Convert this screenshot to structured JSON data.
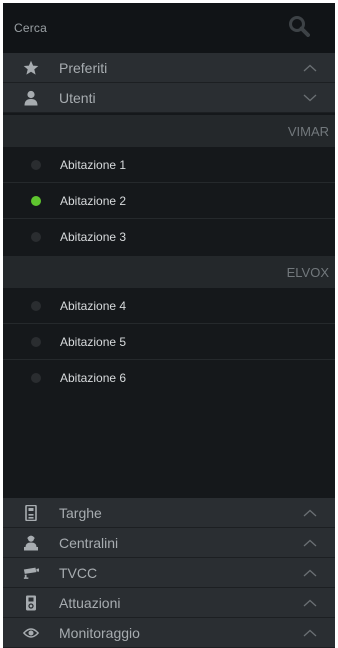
{
  "search": {
    "placeholder": "Cerca",
    "icon": "search-icon"
  },
  "sections_top": [
    {
      "label": "Preferiti",
      "icon": "star-icon",
      "expanded": false
    },
    {
      "label": "Utenti",
      "icon": "user-icon",
      "expanded": true
    }
  ],
  "groups": [
    {
      "name": "VIMAR",
      "users": [
        {
          "label": "Abitazione 1",
          "online": false
        },
        {
          "label": "Abitazione 2",
          "online": true
        },
        {
          "label": "Abitazione 3",
          "online": false
        }
      ]
    },
    {
      "name": "ELVOX",
      "users": [
        {
          "label": "Abitazione 4",
          "online": false
        },
        {
          "label": "Abitazione 5",
          "online": false
        },
        {
          "label": "Abitazione 6",
          "online": false
        }
      ]
    }
  ],
  "sections_bottom": [
    {
      "label": "Targhe",
      "icon": "intercom-panel-icon",
      "expanded": false
    },
    {
      "label": "Centralini",
      "icon": "switchboard-operator-icon",
      "expanded": false
    },
    {
      "label": "TVCC",
      "icon": "cctv-camera-icon",
      "expanded": false
    },
    {
      "label": "Attuazioni",
      "icon": "actuator-icon",
      "expanded": false
    },
    {
      "label": "Monitoraggio",
      "icon": "eye-icon",
      "expanded": false
    }
  ],
  "colors": {
    "background": "#15181b",
    "section_header": "#2a2e32",
    "group_header": "#24282b",
    "online": "#5fc52f",
    "offline": "#2a2d30"
  }
}
